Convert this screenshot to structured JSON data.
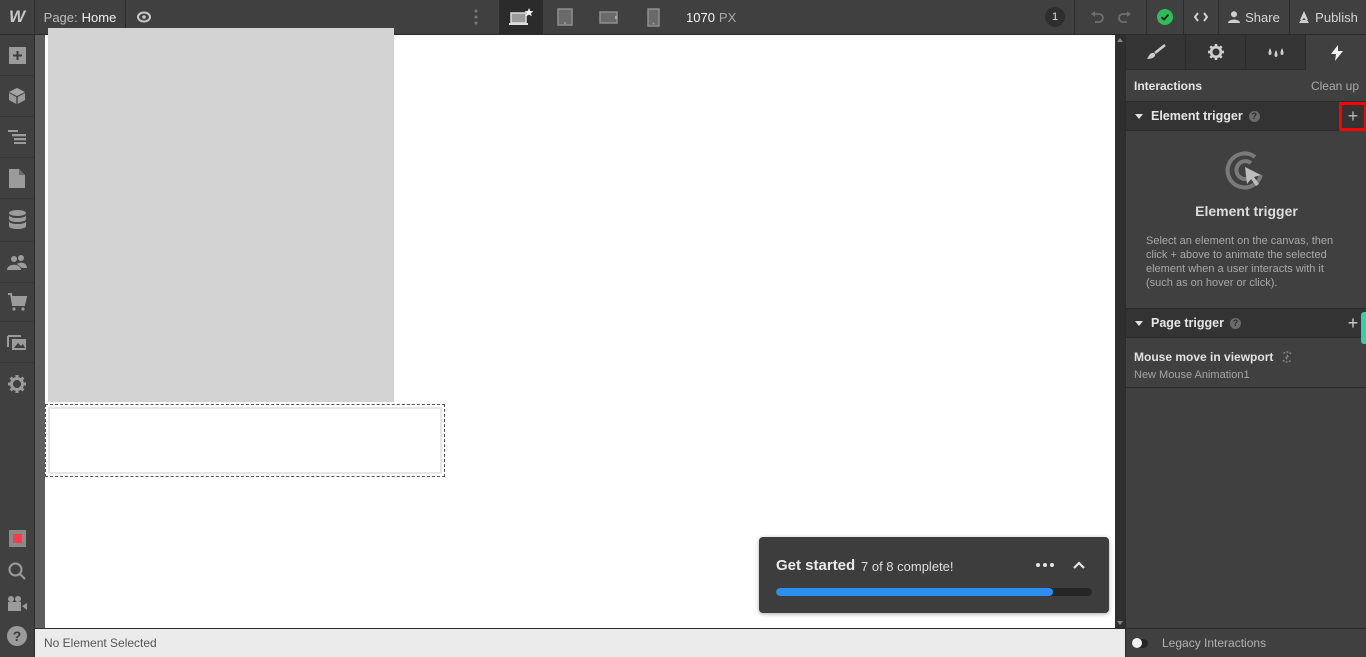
{
  "topbar": {
    "logo": "W",
    "page_key": "Page:",
    "page_value": "Home",
    "breakpoints": [
      {
        "name": "desktop-base",
        "active": true
      },
      {
        "name": "tablet",
        "active": false
      },
      {
        "name": "mobile-landscape",
        "active": false
      },
      {
        "name": "mobile-portrait",
        "active": false
      }
    ],
    "width_value": "1070",
    "width_unit": "PX",
    "notification_count": "1",
    "share_label": "Share",
    "publish_label": "Publish",
    "status_color": "#2dbd5b"
  },
  "left_sidebar": {
    "items": [
      "add-panel",
      "symbols",
      "navigator",
      "pages",
      "cms",
      "users",
      "ecommerce",
      "assets",
      "settings"
    ],
    "bottom_items": [
      "audit",
      "search",
      "video-tutorials",
      "help"
    ]
  },
  "canvas": {
    "status": "No Element Selected"
  },
  "get_started": {
    "title": "Get started",
    "subtitle": "7 of 8 complete!",
    "progress": 0.875,
    "accent": "#2a8ef2"
  },
  "right_panel": {
    "tabs": [
      "style",
      "settings",
      "style-manager",
      "interactions"
    ],
    "active_tab": "interactions",
    "header_title": "Interactions",
    "header_action": "Clean up",
    "element_trigger": {
      "label": "Element trigger",
      "help": "?",
      "add": "+",
      "empty_title": "Element trigger",
      "empty_desc": "Select an element on the canvas, then click + above to animate the selected element when a user interacts with it (such as on hover or click)."
    },
    "page_trigger": {
      "label": "Page trigger",
      "help": "?",
      "add": "+",
      "items": [
        {
          "name": "Mouse move in viewport",
          "animation": "New Mouse Animation1"
        }
      ]
    },
    "legacy_label": "Legacy Interactions"
  }
}
